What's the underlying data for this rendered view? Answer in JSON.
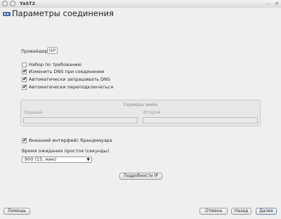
{
  "window": {
    "title": "YaST2",
    "right_controls": [
      "–",
      "×"
    ]
  },
  "header": {
    "icon": "network-card-icon",
    "title": "Параметры соединения"
  },
  "provider": {
    "label": "Провайдер:",
    "value": "ISP"
  },
  "checkboxes": [
    {
      "label": "Набор по требованию",
      "checked": false
    },
    {
      "label": "Изменить DNS при соединении",
      "checked": true
    },
    {
      "label": "Автоматически запрашивать DNS",
      "checked": true
    },
    {
      "label": "Автоматически переподключаться",
      "checked": true
    }
  ],
  "name_servers": {
    "title": "Серверы имён",
    "first_label": "Первый",
    "second_label": "Второй",
    "first_value": "",
    "second_value": ""
  },
  "firewall": {
    "label": "Внешний интерфейс брандмауэра",
    "checked": true
  },
  "idle_timeout": {
    "label": "Время ожидания простоя (секунды)",
    "value": "900 (15. мин)"
  },
  "details_button": "Подробности IP",
  "footer": {
    "help": "Помощь",
    "cancel": "Отмена",
    "back": "Назад",
    "next": "Далее"
  }
}
